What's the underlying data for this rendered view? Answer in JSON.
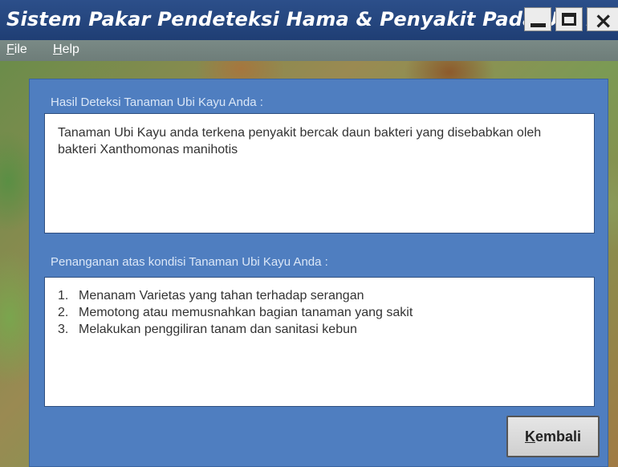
{
  "window": {
    "title": "Sistem Pakar Pendeteksi Hama & Penyakit Pada Ubi Kayu",
    "controls": {
      "minimize_icon": "minimize-icon",
      "maximize_icon": "maximize-icon",
      "close_icon": "close-icon",
      "close_glyph": "×"
    }
  },
  "menu": {
    "file": {
      "mnemonic": "F",
      "rest": "ile"
    },
    "help": {
      "mnemonic": "H",
      "rest": "elp"
    }
  },
  "result": {
    "label": "Hasil Deteksi Tanaman Ubi Kayu Anda :",
    "text": "Tanaman Ubi Kayu anda terkena penyakit bercak daun bakteri yang disebabkan oleh bakteri Xanthomonas manihotis"
  },
  "treatment": {
    "label": "Penanganan atas kondisi Tanaman Ubi Kayu Anda :",
    "items": [
      {
        "num": "1.",
        "text": "Menanam Varietas yang tahan terhadap serangan"
      },
      {
        "num": "2.",
        "text": "Memotong atau memusnahkan bagian tanaman yang sakit"
      },
      {
        "num": "3.",
        "text": "Melakukan penggiliran tanam dan sanitasi kebun"
      }
    ]
  },
  "back_button": {
    "mnemonic": "K",
    "rest": "embali"
  },
  "colors": {
    "titlebar": "#1f3e74",
    "panel": "#4f7ec0",
    "label_text": "#dbe7f7"
  }
}
